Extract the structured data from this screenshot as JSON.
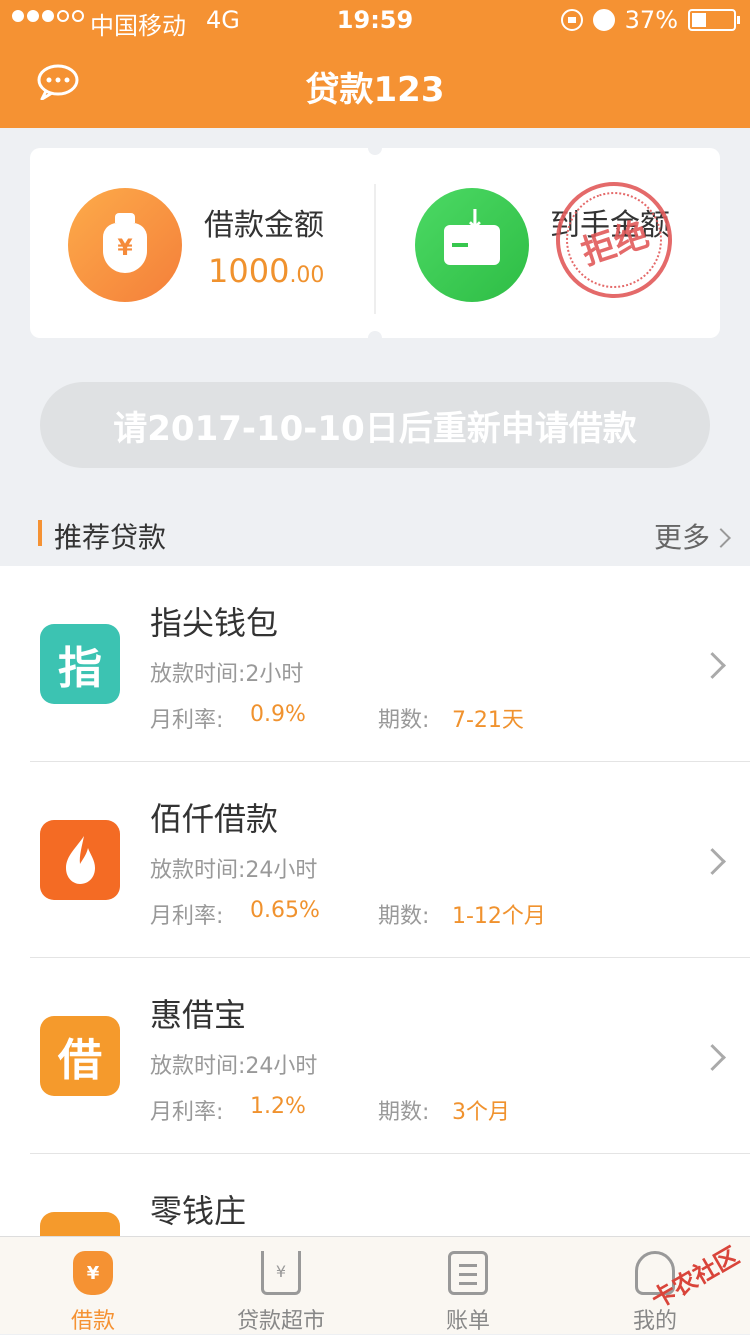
{
  "status_bar": {
    "carrier": "中国移动",
    "network": "4G",
    "time": "19:59",
    "battery": "37%"
  },
  "nav": {
    "title": "贷款123",
    "chat_icon": "chat-bubble-icon"
  },
  "amount_card": {
    "borrow_label": "借款金额",
    "borrow_amount": "1000",
    "borrow_cents": ".00",
    "received_label": "到手金额",
    "stamp_text": "拒绝",
    "borrow_icon": "money-bag-icon",
    "received_icon": "wallet-icon"
  },
  "reapply_button": "请2017-10-10日后重新申请借款",
  "section": {
    "title": "推荐贷款",
    "more": "更多"
  },
  "loans": [
    {
      "name": "指尖钱包",
      "logo_text": "指",
      "logo_color": "#3cc3b2",
      "time": "放款时间:2小时",
      "rate_label": "月利率:",
      "rate": "0.9%",
      "term_label": "期数:",
      "term": "7-21天"
    },
    {
      "name": "佰仟借款",
      "logo_text": "💧",
      "logo_color": "#f46b24",
      "time": "放款时间:24小时",
      "rate_label": "月利率:",
      "rate": "0.65%",
      "term_label": "期数:",
      "term": "1-12个月"
    },
    {
      "name": "惠借宝",
      "logo_text": "借",
      "logo_color": "#f59a2c",
      "time": "放款时间:24小时",
      "rate_label": "月利率:",
      "rate": "1.2%",
      "term_label": "期数:",
      "term": "3个月"
    },
    {
      "name": "零钱庄",
      "logo_text": "",
      "logo_color": "#f59a2c",
      "time": "",
      "rate_label": "",
      "rate": "",
      "term_label": "",
      "term": ""
    }
  ],
  "tabs": [
    {
      "label": "借款",
      "icon": "money-bag-icon",
      "active": true
    },
    {
      "label": "贷款超市",
      "icon": "cart-icon",
      "active": false
    },
    {
      "label": "账单",
      "icon": "bill-icon",
      "active": false
    },
    {
      "label": "我的",
      "icon": "user-icon",
      "active": false
    }
  ],
  "watermark": "卡农社区",
  "colors": {
    "brand": "#f59233",
    "accent_text": "#f0922e",
    "stamp": "#e25a5a"
  }
}
